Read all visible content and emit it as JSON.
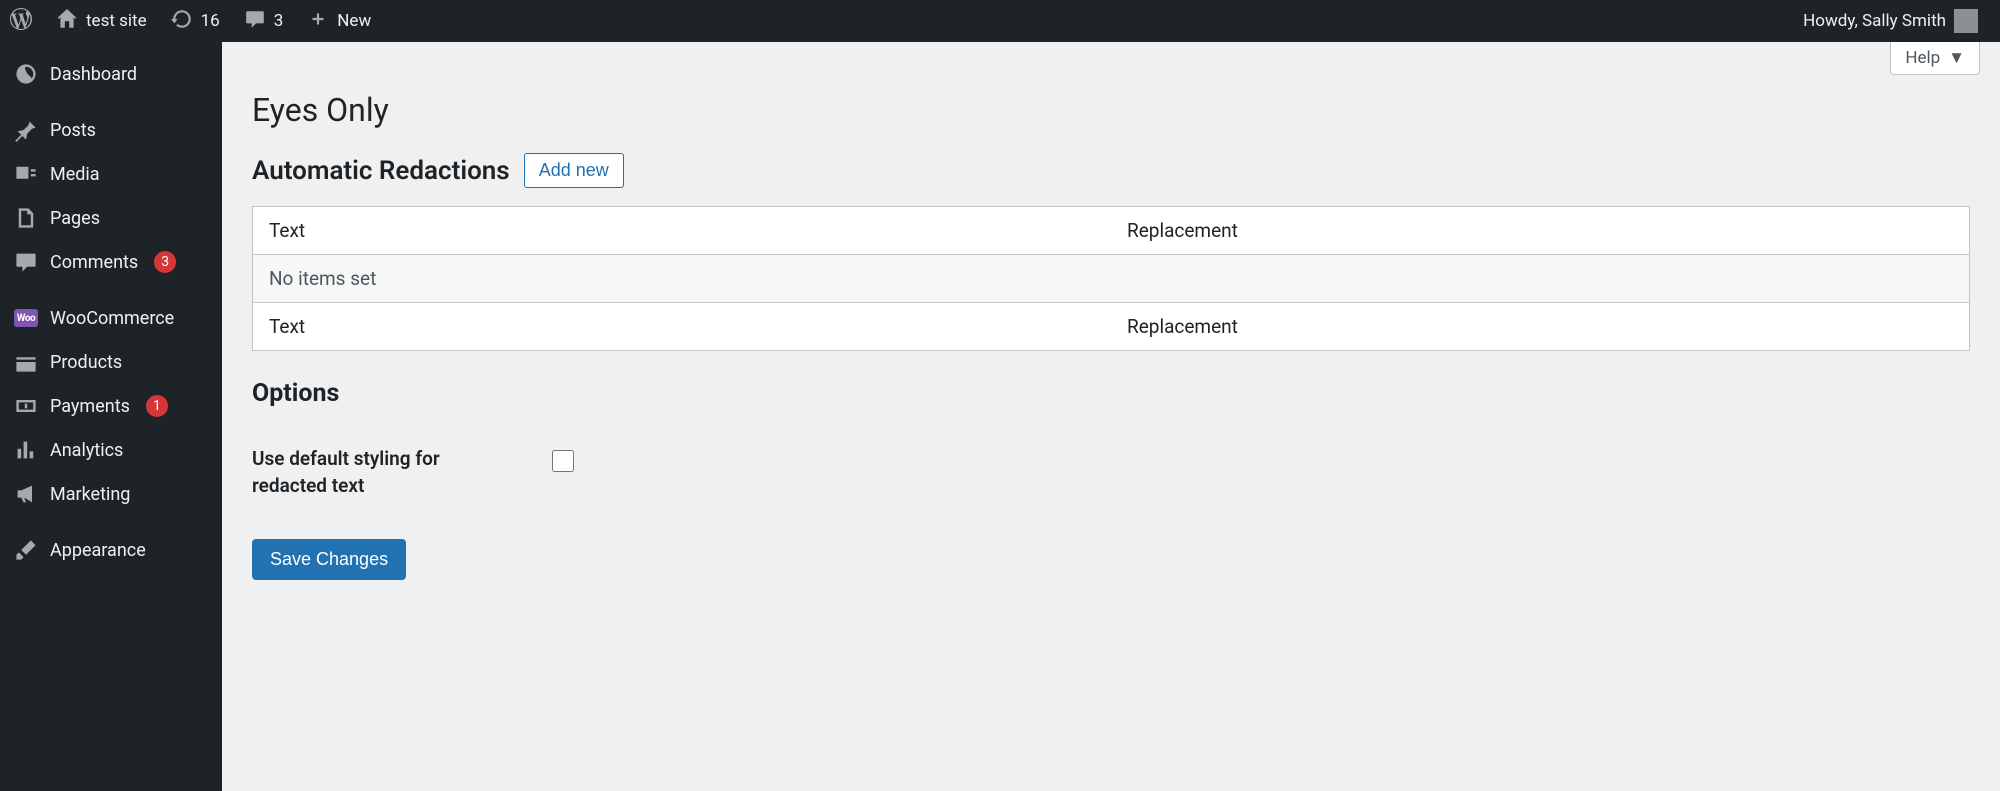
{
  "adminbar": {
    "site_name": "test site",
    "updates_count": "16",
    "comments_count": "3",
    "new_label": "New",
    "howdy": "Howdy, Sally Smith"
  },
  "sidebar": {
    "dashboard": "Dashboard",
    "posts": "Posts",
    "media": "Media",
    "pages": "Pages",
    "comments": "Comments",
    "comments_badge": "3",
    "woocommerce": "WooCommerce",
    "products": "Products",
    "payments": "Payments",
    "payments_badge": "1",
    "analytics": "Analytics",
    "marketing": "Marketing",
    "appearance": "Appearance"
  },
  "main": {
    "help_label": "Help",
    "page_title": "Eyes Only",
    "section_redactions": "Automatic Redactions",
    "add_new": "Add new",
    "table": {
      "col_text": "Text",
      "col_replacement": "Replacement",
      "empty_msg": "No items set"
    },
    "options_title": "Options",
    "default_styling_label": "Use default styling for redacted text",
    "save_label": "Save Changes"
  }
}
